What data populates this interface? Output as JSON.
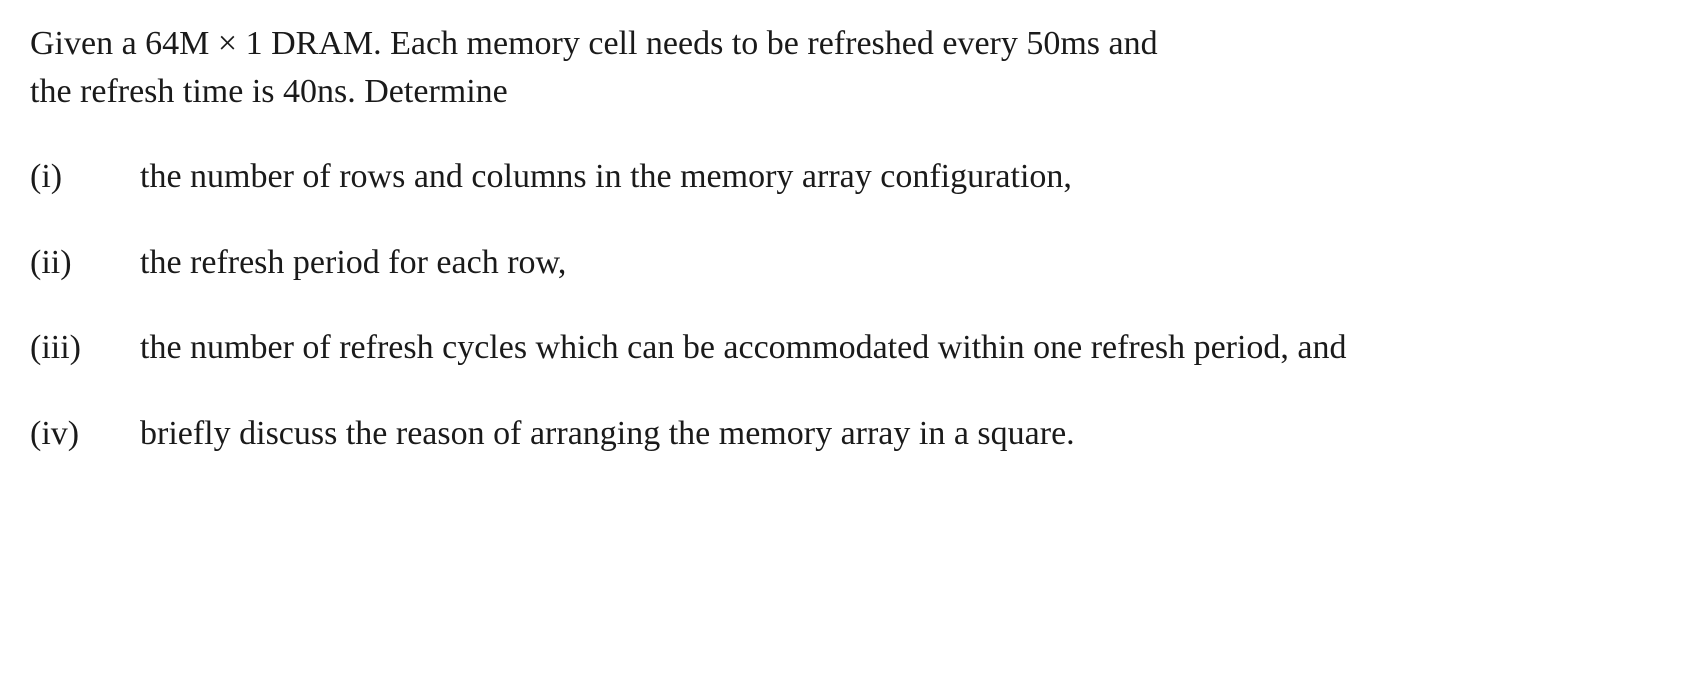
{
  "intro": {
    "line1": "Given a 64M × 1 DRAM.  Each memory cell needs to be refreshed every 50ms and",
    "line2": "the refresh time is 40ns.  Determine"
  },
  "questions": [
    {
      "label": "(i)",
      "text": "the number of rows and columns in the memory array configuration,"
    },
    {
      "label": "(ii)",
      "text": "the refresh period for each row,"
    },
    {
      "label": "(iii)",
      "text": "the number of refresh cycles which can be accommodated within one refresh period, and"
    },
    {
      "label": "(iv)",
      "text": "briefly discuss the reason of arranging the memory array in a square."
    }
  ]
}
